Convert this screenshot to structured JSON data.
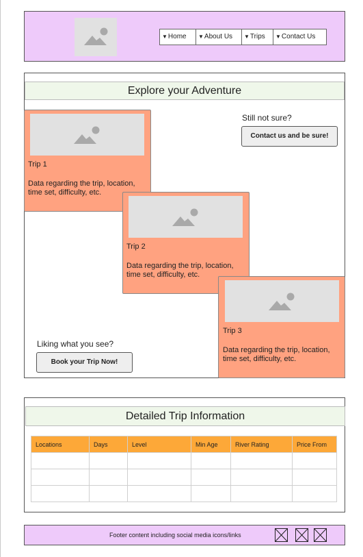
{
  "header": {
    "logo_icon": "image-placeholder-icon",
    "nav": [
      {
        "caret": "▼",
        "label": "Home"
      },
      {
        "caret": "▼",
        "label": "About Us"
      },
      {
        "caret": "▼",
        "label": "Trips"
      },
      {
        "caret": "▼",
        "label": "Contact Us"
      }
    ]
  },
  "adventure": {
    "title": "Explore your Adventure",
    "still_not_sure": "Still not sure?",
    "contact_button": "Contact us and be sure!",
    "liking": "Liking what you see?",
    "book_button": "Book your Trip Now!",
    "trips": [
      {
        "name": "Trip 1",
        "description": "Data regarding the trip, location, time set, difficulty, etc."
      },
      {
        "name": "Trip 2",
        "description": "Data regarding the trip, location, time set, difficulty, etc."
      },
      {
        "name": "Trip 3",
        "description": "Data regarding the trip, location, time set, difficulty, etc."
      }
    ]
  },
  "details": {
    "title": "Detailed Trip Information",
    "columns": [
      "Locations",
      "Days",
      "Level",
      "Min Age",
      "River Rating",
      "Price From"
    ]
  },
  "footer": {
    "text": "Footer content including social media icons/links",
    "social_icons": [
      "social-icon-placeholder",
      "social-icon-placeholder",
      "social-icon-placeholder"
    ]
  },
  "colors": {
    "header_bg": "#eecafa",
    "title_bar_bg": "#eff7ea",
    "trip_card_bg": "#ffa280",
    "table_header_bg": "#fda838",
    "placeholder_bg": "#e1e1e1"
  }
}
